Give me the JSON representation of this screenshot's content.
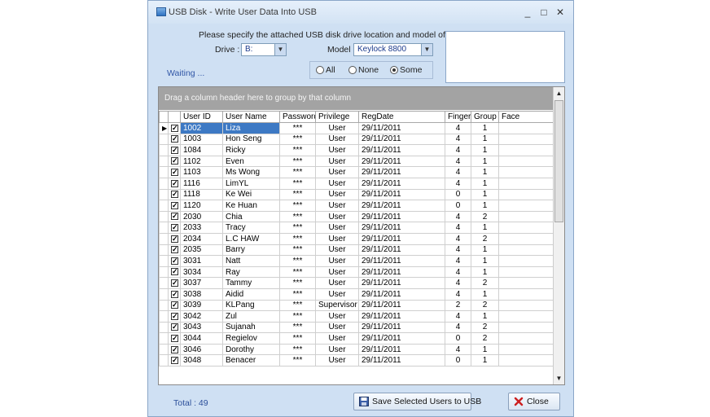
{
  "window": {
    "title": "USB Disk - Write User Data Into USB",
    "controls": [
      "_",
      "□",
      "✕"
    ]
  },
  "form": {
    "instruction": "Please specify the attached USB disk drive location and model of terminal :-",
    "drive_label": "Drive :",
    "drive_value": "B:",
    "model_label": "Model :",
    "model_value": "Keylock 8800",
    "status": "Waiting ...",
    "radios": [
      {
        "label": "All",
        "checked": false
      },
      {
        "label": "None",
        "checked": false
      },
      {
        "label": "Some",
        "checked": true
      }
    ]
  },
  "grid": {
    "group_hint": "Drag a column header here to group by that column",
    "columns": [
      "User ID",
      "User Name",
      "Password",
      "Privilege",
      "RegDate",
      "Finger",
      "Group",
      "Face"
    ],
    "rows": [
      [
        "1002",
        "Liza",
        "***",
        "User",
        "29/11/2011",
        "4",
        "1",
        ""
      ],
      [
        "1003",
        "Hon Seng",
        "***",
        "User",
        "29/11/2011",
        "4",
        "1",
        ""
      ],
      [
        "1084",
        "Ricky",
        "***",
        "User",
        "29/11/2011",
        "4",
        "1",
        ""
      ],
      [
        "1102",
        "Even",
        "***",
        "User",
        "29/11/2011",
        "4",
        "1",
        ""
      ],
      [
        "1103",
        "Ms Wong",
        "***",
        "User",
        "29/11/2011",
        "4",
        "1",
        ""
      ],
      [
        "1116",
        "LimYL",
        "***",
        "User",
        "29/11/2011",
        "4",
        "1",
        ""
      ],
      [
        "1118",
        "Ke Wei",
        "***",
        "User",
        "29/11/2011",
        "0",
        "1",
        ""
      ],
      [
        "1120",
        "Ke Huan",
        "***",
        "User",
        "29/11/2011",
        "0",
        "1",
        ""
      ],
      [
        "2030",
        "Chia",
        "***",
        "User",
        "29/11/2011",
        "4",
        "2",
        ""
      ],
      [
        "2033",
        "Tracy",
        "***",
        "User",
        "29/11/2011",
        "4",
        "1",
        ""
      ],
      [
        "2034",
        "L.C HAW",
        "***",
        "User",
        "29/11/2011",
        "4",
        "2",
        ""
      ],
      [
        "2035",
        "Barry",
        "***",
        "User",
        "29/11/2011",
        "4",
        "1",
        ""
      ],
      [
        "3031",
        "Natt",
        "***",
        "User",
        "29/11/2011",
        "4",
        "1",
        ""
      ],
      [
        "3034",
        "Ray",
        "***",
        "User",
        "29/11/2011",
        "4",
        "1",
        ""
      ],
      [
        "3037",
        "Tammy",
        "***",
        "User",
        "29/11/2011",
        "4",
        "2",
        ""
      ],
      [
        "3038",
        "Aidid",
        "***",
        "User",
        "29/11/2011",
        "4",
        "1",
        ""
      ],
      [
        "3039",
        "KLPang",
        "***",
        "Supervisor",
        "29/11/2011",
        "2",
        "2",
        ""
      ],
      [
        "3042",
        "Zul",
        "***",
        "User",
        "29/11/2011",
        "4",
        "1",
        ""
      ],
      [
        "3043",
        "Sujanah",
        "***",
        "User",
        "29/11/2011",
        "4",
        "2",
        ""
      ],
      [
        "3044",
        "Regielov",
        "***",
        "User",
        "29/11/2011",
        "0",
        "2",
        ""
      ],
      [
        "3046",
        "Dorothy",
        "***",
        "User",
        "29/11/2011",
        "4",
        "1",
        ""
      ],
      [
        "3048",
        "Benacer",
        "***",
        "User",
        "29/11/2011",
        "0",
        "1",
        ""
      ]
    ]
  },
  "footer": {
    "total": "Total : 49",
    "save_label": "Save Selected Users to USB",
    "close_label": "Close"
  },
  "colors": {
    "selection": "#3d79c4",
    "window_bg": "#cfe0f3",
    "status_text": "#2c4f9a"
  }
}
